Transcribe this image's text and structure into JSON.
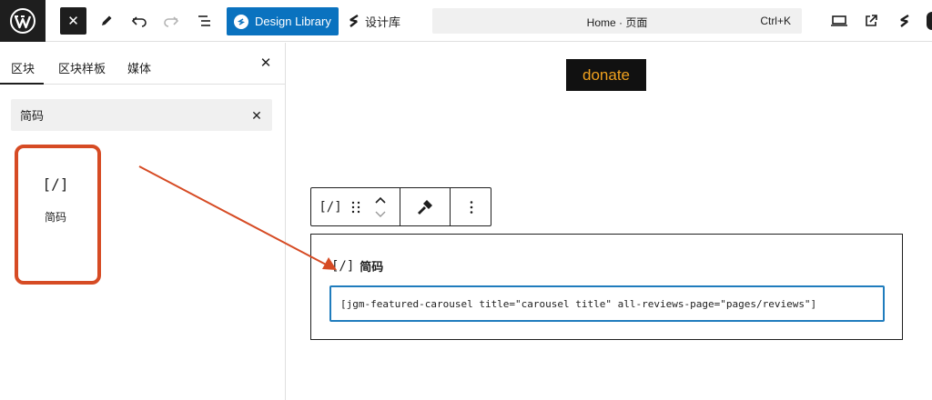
{
  "toolbar": {
    "close_label": "✕",
    "design_library_label": "Design Library",
    "sheji_label": "设计库",
    "command_title": "Home · 页面",
    "command_shortcut": "Ctrl+K"
  },
  "sidebar": {
    "tabs": [
      {
        "label": "区块",
        "active": true
      },
      {
        "label": "区块样板",
        "active": false
      },
      {
        "label": "媒体",
        "active": false
      }
    ],
    "search_value": "简码",
    "results": [
      {
        "icon": "[/]",
        "label": "简码"
      }
    ]
  },
  "canvas": {
    "donate_label": "donate",
    "block_toolbar": {
      "block_icon": "[/]"
    },
    "shortcode_block": {
      "icon": "[/]",
      "title": "简码",
      "value": "[jgm-featured-carousel title=\"carousel title\" all-reviews-page=\"pages/reviews\"]"
    }
  },
  "colors": {
    "accent_blue": "#0a72bf",
    "highlight_red": "#d64b24",
    "donate_text": "#f0a11e",
    "dark": "#1e1e1e"
  },
  "icons": [
    "wordpress-logo-icon",
    "close-icon",
    "pen-icon",
    "undo-icon",
    "redo-icon",
    "list-view-icon",
    "design-library-icon",
    "stackable-icon",
    "desktop-view-icon",
    "external-link-icon",
    "drag-handle-icon",
    "move-up-icon",
    "move-down-icon",
    "tools-icon",
    "more-options-icon",
    "clear-search-icon"
  ]
}
